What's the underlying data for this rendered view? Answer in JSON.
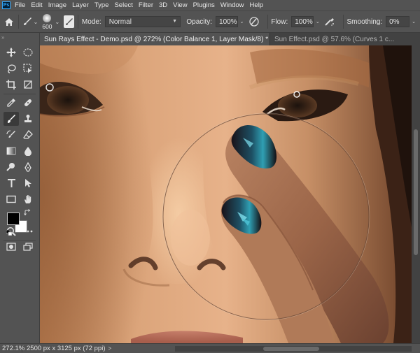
{
  "app": {
    "logo_text": "Ps"
  },
  "menu": [
    "File",
    "Edit",
    "Image",
    "Layer",
    "Type",
    "Select",
    "Filter",
    "3D",
    "View",
    "Plugins",
    "Window",
    "Help"
  ],
  "options": {
    "brush_size": "600",
    "mode_label": "Mode:",
    "mode_value": "Normal",
    "opacity_label": "Opacity:",
    "opacity_value": "100%",
    "flow_label": "Flow:",
    "flow_value": "100%",
    "smoothing_label": "Smoothing:",
    "smoothing_value": "0%"
  },
  "tabs": [
    {
      "label": "Sun Rays Effect - Demo.psd @ 272% (Color Balance 1, Layer Mask/8) *",
      "close": "×"
    },
    {
      "label": "Sun Effect.psd @ 57.6% (Curves 1 c..."
    }
  ],
  "toolbar": {
    "tools": [
      "move",
      "marquee",
      "lasso",
      "object-selection",
      "crop",
      "frame",
      "eyedropper",
      "healing",
      "brush",
      "clone-stamp",
      "history-brush",
      "eraser",
      "gradient",
      "blur",
      "dodge",
      "pen",
      "type",
      "path-selection",
      "rectangle",
      "hand",
      "zoom",
      "more"
    ],
    "selected_tool": "brush",
    "foreground_color": "#000000",
    "background_color": "#ffffff"
  },
  "status": {
    "zoom": "272.1%",
    "doc_info": "2500 px x 3125 px (72 ppi)",
    "caret": ">"
  }
}
